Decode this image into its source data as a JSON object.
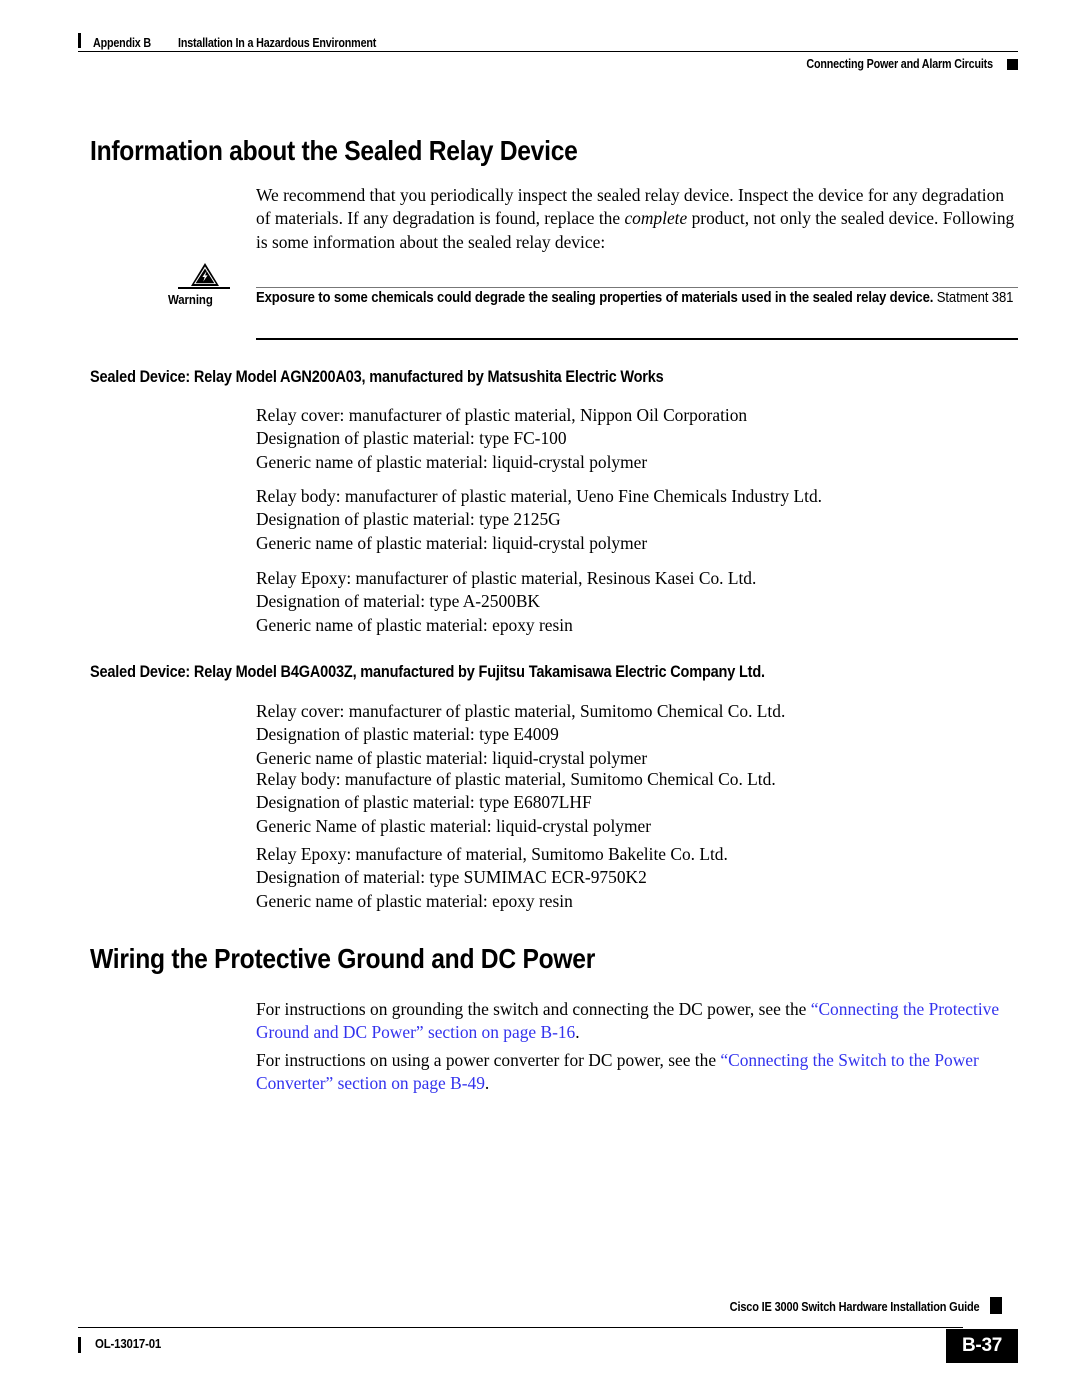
{
  "header": {
    "appendix": "Appendix B",
    "chapter_title": "Installation In a Hazardous Environment",
    "section_title": "Connecting Power and Alarm Circuits"
  },
  "sections": [
    {
      "heading": "Information about the Sealed Relay Device",
      "intro_paragraph": "We recommend that you periodically inspect the sealed relay device. Inspect the device for any degradation of materials. If any degradation is found, replace the complete product, not only the sealed device. Following is some information about the sealed relay device:",
      "intro_parts": {
        "before_italic": "We recommend that you periodically inspect the sealed relay device. Inspect the device for any degradation of materials. If any degradation is found, replace the ",
        "italic": "complete",
        "after_italic": " product, not only the sealed device. Following is some information about the sealed relay device:"
      }
    }
  ],
  "warning": {
    "label": "Warning",
    "icon": "warning-lightning-triangle-icon",
    "bold_text": "Exposure to some chemicals could degrade the sealing properties of materials used in the sealed relay device.",
    "statement": " Statment 381"
  },
  "subsection_1": {
    "heading": "Sealed Device: Relay Model AGN200A03, manufactured by Matsushita Electric Works",
    "groups": [
      [
        "Relay cover: manufacturer of plastic material, Nippon Oil Corporation",
        "Designation of plastic material: type FC-100",
        "Generic name of plastic material: liquid-crystal polymer"
      ],
      [
        "Relay body: manufacturer of plastic material, Ueno Fine Chemicals Industry Ltd.",
        "Designation of plastic material: type 2125G",
        "Generic name of plastic material: liquid-crystal polymer"
      ],
      [
        "Relay Epoxy: manufacturer of plastic material, Resinous Kasei Co. Ltd.",
        "Designation of material: type A-2500BK",
        "Generic name of plastic material: epoxy resin"
      ]
    ]
  },
  "subsection_2": {
    "heading": "Sealed Device: Relay Model B4GA003Z, manufactured by Fujitsu Takamisawa Electric Company Ltd.",
    "groups": [
      [
        "Relay cover: manufacturer of plastic material, Sumitomo Chemical Co. Ltd.",
        "Designation of plastic material: type E4009",
        "Generic name of plastic material: liquid-crystal polymer"
      ],
      [
        "Relay body: manufacture of plastic material, Sumitomo Chemical Co. Ltd.",
        "Designation of plastic material: type E6807LHF",
        "Generic Name of plastic material: liquid-crystal polymer"
      ],
      [
        "Relay Epoxy: manufacture of material, Sumitomo Bakelite Co. Ltd.",
        "Designation of material: type SUMIMAC ECR-9750K2",
        "Generic name of plastic material: epoxy resin"
      ]
    ]
  },
  "section_wiring": {
    "heading": "Wiring the Protective Ground and DC Power",
    "paragraph_1": {
      "lead": "For instructions on grounding the switch and connecting the DC power, see the ",
      "link": "“Connecting the Protective Ground and DC Power” section on page B-16",
      "tail": "."
    },
    "paragraph_2": {
      "lead": "For instructions on using a power converter for DC power, see the ",
      "link": "“Connecting the Switch to the Power Converter” section on page B-49",
      "tail": "."
    }
  },
  "footer": {
    "guide_title": "Cisco IE 3000 Switch Hardware Installation Guide",
    "doc_number": "OL-13017-01",
    "page_number": "B-37"
  },
  "colors": {
    "link": "#3333ee",
    "text": "#000000",
    "rule": "#000000",
    "warning_rule_light": "#777777"
  }
}
